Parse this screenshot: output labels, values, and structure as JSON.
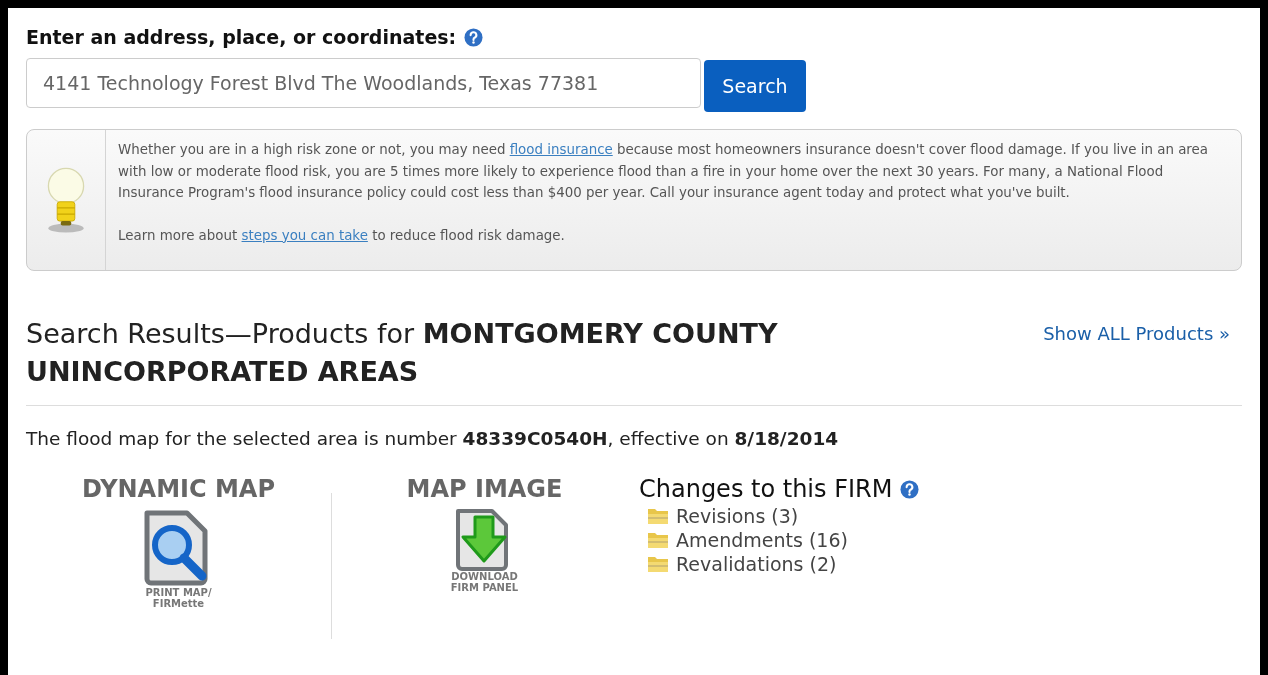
{
  "search": {
    "label": "Enter an address, place, or coordinates:",
    "value": "4141 Technology Forest Blvd The Woodlands, Texas 77381",
    "button": "Search"
  },
  "tip": {
    "parts": [
      {
        "text": "Whether you are in a high risk zone or not, you may need ",
        "kind": "text"
      },
      {
        "text": "flood insurance",
        "kind": "link"
      },
      {
        "text": " because most homeowners insurance doesn't cover flood damage. If you live in an area with low or moderate flood risk, you are 5 times more likely to experience flood than a fire in your home over the next 30 years. For many, a National Flood Insurance Program's flood insurance policy could cost less than $400 per year. Call your insurance agent today and protect what you've built.",
        "kind": "text"
      }
    ],
    "learn": [
      {
        "text": "Learn more about ",
        "kind": "text"
      },
      {
        "text": "steps you can take",
        "kind": "link"
      },
      {
        "text": " to reduce flood risk damage.",
        "kind": "text"
      }
    ]
  },
  "results": {
    "heading": "Search Results—Products for **MONTGOMERY COUNTY UNINCORPORATED AREAS**",
    "show_all": "Show ALL Products »",
    "summary": "The flood map for the selected area is number **48339C0540H**, effective on **8/18/2014**"
  },
  "products": [
    {
      "title": "DYNAMIC MAP",
      "caption": [
        "PRINT MAP/",
        "FIRMette"
      ],
      "kind": "print"
    },
    {
      "title": "MAP IMAGE",
      "caption": [
        "DOWNLOAD",
        "FIRM PANEL"
      ],
      "kind": "download"
    }
  ],
  "changes": {
    "title": "Changes to this FIRM",
    "items": [
      "Revisions (3)",
      "Amendments (16)",
      "Revalidations (2)"
    ]
  }
}
